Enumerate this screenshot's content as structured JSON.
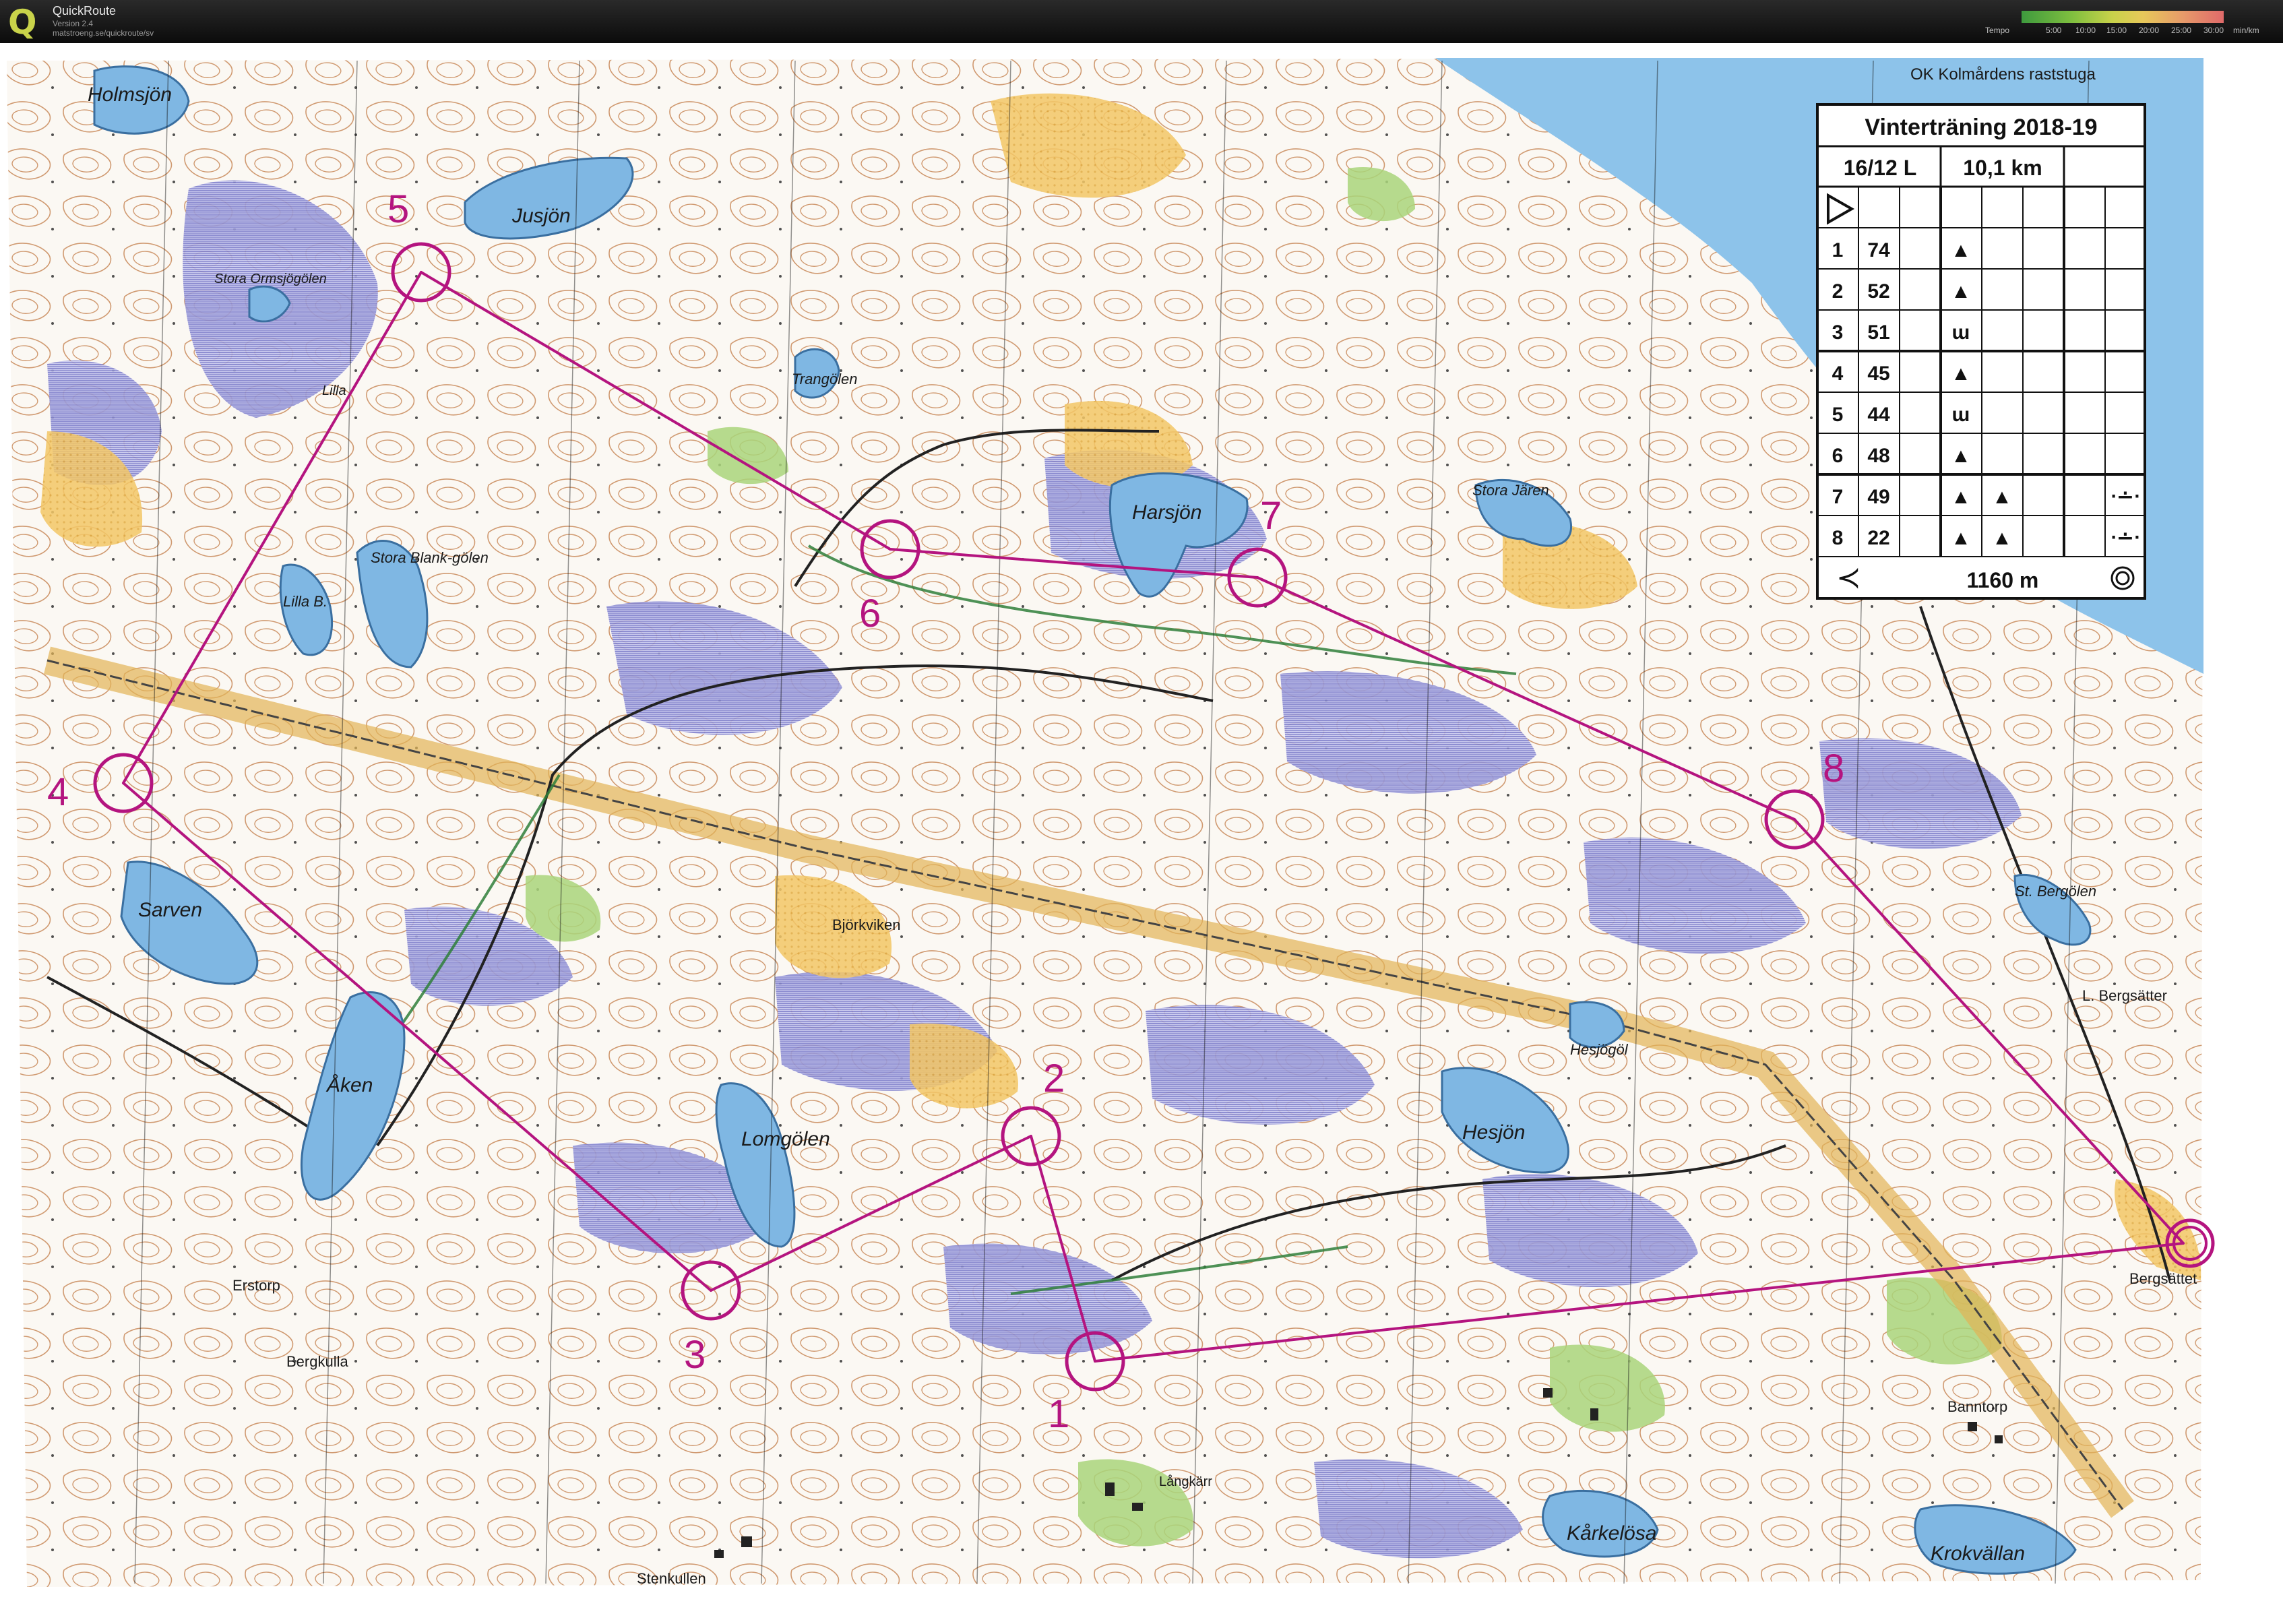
{
  "app": {
    "title": "QuickRoute",
    "version": "Version 2.4",
    "url": "matstroeng.se/quickroute/sv",
    "logo_letter": "Q"
  },
  "tempo_scale": {
    "label": "Tempo",
    "ticks": [
      "5:00",
      "10:00",
      "15:00",
      "20:00",
      "25:00",
      "30:00"
    ],
    "unit": "min/km"
  },
  "map": {
    "colors": {
      "lake": "#7fb7e3",
      "open_land": "#f2c45a",
      "marsh": "#8f8fd6",
      "contour": "#b06a3a",
      "green": "#9ccd6a",
      "course": "#b4147f"
    },
    "place_names": [
      "Holmsjön",
      "Jusjön",
      "Stora Ormsjögölen",
      "Lilla",
      "Trangölen",
      "Harsjön",
      "Stora Jären",
      "Stora Blank-gölen",
      "Lilla B.",
      "Sarven",
      "Åken",
      "Björkviken",
      "Lomgölen",
      "Hesjögöl",
      "Hesjön",
      "St. Bergölen",
      "L. Bergsätter",
      "Bergsättet",
      "Banntorp",
      "Långkärr",
      "Kårkelösa",
      "Krokvällan",
      "Stenkullen",
      "Erstorp",
      "Bergkulla",
      "OK Kolmårdens raststuga"
    ],
    "control_numbers": [
      "1",
      "2",
      "3",
      "4",
      "5",
      "6",
      "7",
      "8"
    ]
  },
  "control_card": {
    "title": "Vinterträning 2018-19",
    "date_class": "16/12 L",
    "length": "10,1 km",
    "start_symbol": "triangle",
    "rows": [
      {
        "n": "1",
        "code": "74",
        "sym": "▲",
        "extra1": "",
        "extra2": ""
      },
      {
        "n": "2",
        "code": "52",
        "sym": "▲",
        "extra1": "",
        "extra2": ""
      },
      {
        "n": "3",
        "code": "51",
        "sym": "ɯ",
        "extra1": "",
        "extra2": ""
      },
      {
        "n": "4",
        "code": "45",
        "sym": "▲",
        "extra1": "",
        "extra2": ""
      },
      {
        "n": "5",
        "code": "44",
        "sym": "ɯ",
        "extra1": "",
        "extra2": ""
      },
      {
        "n": "6",
        "code": "48",
        "sym": "▲",
        "extra1": "",
        "extra2": ""
      },
      {
        "n": "7",
        "code": "49",
        "sym": "▲",
        "extra1": "▲",
        "extra2": "⋅∸⋅"
      },
      {
        "n": "8",
        "code": "22",
        "sym": "▲",
        "extra1": "▲",
        "extra2": "⋅∸⋅"
      }
    ],
    "finish_distance": "1160 m"
  }
}
